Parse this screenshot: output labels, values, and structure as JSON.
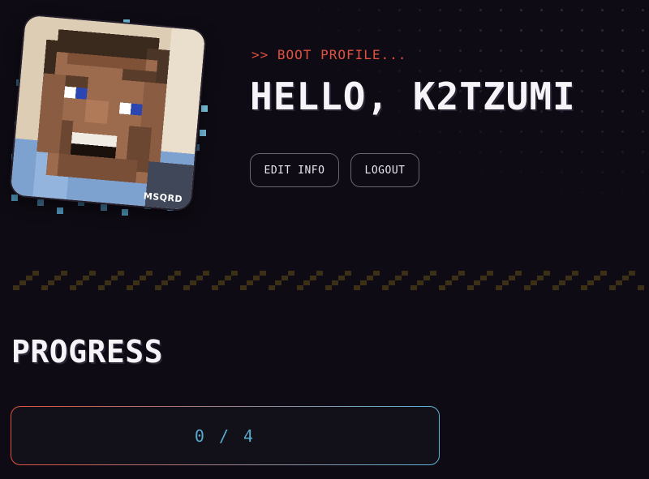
{
  "profile": {
    "boot_line": ">> BOOT PROFILE...",
    "greeting": "HELLO, K2TZUMI",
    "avatar_tag": "MSQRD"
  },
  "actions": {
    "edit_label": "EDIT INFO",
    "logout_label": "LOGOUT"
  },
  "progress": {
    "heading": "PROGRESS",
    "completed": 0,
    "total": 4,
    "display": "0 / 4"
  },
  "colors": {
    "background": "#0e0b14",
    "accent_red": "#e0513f",
    "accent_blue": "#5aa8cc",
    "divider_gold": "#3b3016"
  }
}
